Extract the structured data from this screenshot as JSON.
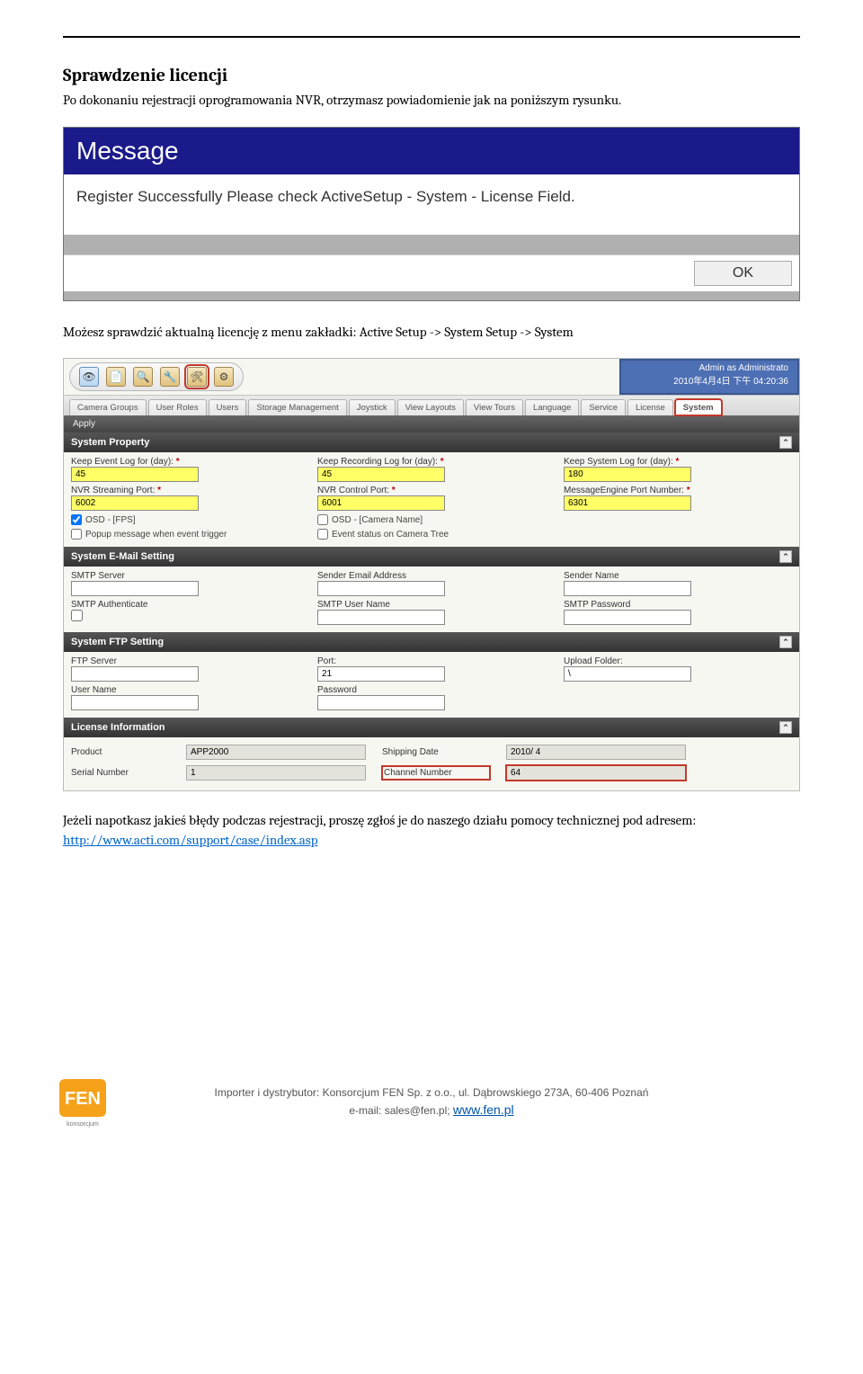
{
  "doc": {
    "heading": "Sprawdzenie licencji",
    "intro": "Po dokonaniu rejestracji oprogramowania NVR, otrzymasz powiadomienie jak na poniższym rysunku.",
    "mid_text": "Możesz sprawdzić aktualną licencję z menu zakładki: Active Setup -> System Setup -> System",
    "closing_pre": "Jeżeli napotkasz jakieś błędy podczas rejestracji, proszę zgłoś je do naszego działu pomocy technicznej pod adresem: ",
    "closing_link": "http://www.acti.com/support/case/index.asp"
  },
  "message_dialog": {
    "title": "Message",
    "body": "Register Successfully  Please check ActiveSetup - System - License Field.",
    "ok": "OK"
  },
  "app": {
    "admin_line1": "Admin as Administrato",
    "admin_line2": "2010年4月4日 下午 04:20:36",
    "tabs": [
      "Camera Groups",
      "User Roles",
      "Users",
      "Storage Management",
      "Joystick",
      "View Layouts",
      "View Tours",
      "Language",
      "Service",
      "License",
      "System"
    ],
    "active_tab_index": 10,
    "apply": "Apply",
    "prop": {
      "title": "System Property",
      "keep_event_label": "Keep Event Log for (day):",
      "keep_event_val": "45",
      "keep_rec_label": "Keep Recording Log for (day):",
      "keep_rec_val": "45",
      "keep_sys_label": "Keep System Log for (day):",
      "keep_sys_val": "180",
      "stream_port_label": "NVR Streaming Port:",
      "stream_port_val": "6002",
      "ctrl_port_label": "NVR Control Port:",
      "ctrl_port_val": "6001",
      "msg_port_label": "MessageEngine Port Number:",
      "msg_port_val": "6301",
      "osd_fps": "OSD - [FPS]",
      "osd_cam": "OSD - [Camera Name]",
      "popup": "Popup message when event trigger",
      "evt_tree": "Event status on Camera Tree"
    },
    "email": {
      "title": "System E-Mail Setting",
      "smtp_server": "SMTP Server",
      "sender_addr": "Sender Email Address",
      "sender_name": "Sender Name",
      "smtp_auth": "SMTP Authenticate",
      "smtp_user": "SMTP User Name",
      "smtp_pass": "SMTP Password"
    },
    "ftp": {
      "title": "System FTP Setting",
      "server": "FTP Server",
      "port": "Port:",
      "port_val": "21",
      "upload": "Upload Folder:",
      "upload_val": "\\",
      "user": "User Name",
      "pass": "Password"
    },
    "lic": {
      "title": "License Information",
      "product": "Product",
      "product_val": "APP2000",
      "ship": "Shipping Date",
      "ship_val": "2010/ 4",
      "serial": "Serial Number",
      "serial_val": "1",
      "channel": "Channel Number",
      "channel_val": "64"
    }
  },
  "footer": {
    "line1": "Importer i dystrybutor: Konsorcjum FEN Sp. z o.o., ul. Dąbrowskiego 273A, 60-406 Poznań",
    "line2_pre": "e-mail: sales@fen.pl; ",
    "line2_link": "www.fen.pl",
    "logo_caption": "konsorcjum"
  }
}
